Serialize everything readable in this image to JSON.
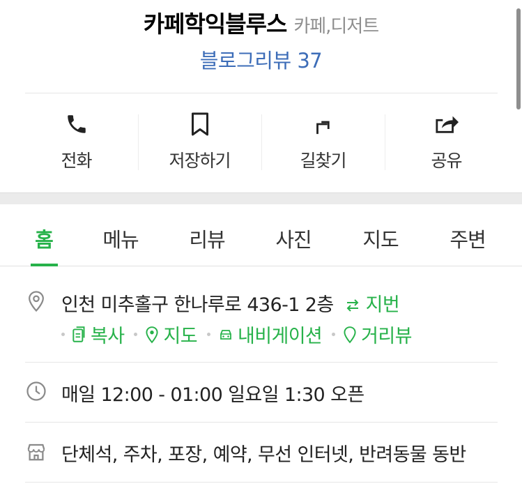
{
  "place": {
    "name": "카페학익블루스",
    "category": "카페,디저트",
    "review_link": "블로그리뷰 37"
  },
  "actions": [
    {
      "label": "전화",
      "icon": "phone-icon"
    },
    {
      "label": "저장하기",
      "icon": "bookmark-icon"
    },
    {
      "label": "길찾기",
      "icon": "directions-icon"
    },
    {
      "label": "공유",
      "icon": "share-icon"
    }
  ],
  "tabs": [
    {
      "label": "홈",
      "active": true
    },
    {
      "label": "메뉴",
      "active": false
    },
    {
      "label": "리뷰",
      "active": false
    },
    {
      "label": "사진",
      "active": false
    },
    {
      "label": "지도",
      "active": false
    },
    {
      "label": "주변",
      "active": false
    }
  ],
  "address": {
    "text": "인천 미추홀구 한나루로 436-1 2층",
    "lot_toggle": "지번",
    "links": [
      {
        "label": "복사",
        "icon": "copy-icon"
      },
      {
        "label": "지도",
        "icon": "map-pin-icon"
      },
      {
        "label": "내비게이션",
        "icon": "car-icon"
      },
      {
        "label": "거리뷰",
        "icon": "streetview-icon"
      }
    ]
  },
  "hours": {
    "text": "매일 12:00 - 01:00 일요일 1:30 오픈"
  },
  "amenities": {
    "text": "단체석, 주차, 포장, 예약, 무선 인터넷, 반려동물 동반"
  },
  "colors": {
    "accent": "#27b24a",
    "link": "#3d6db8",
    "muted": "#8e8e8e"
  }
}
